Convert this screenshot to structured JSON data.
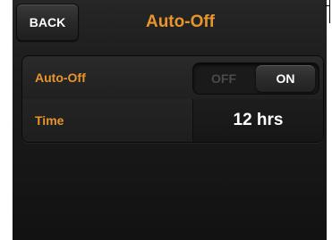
{
  "header": {
    "back_label": "BACK",
    "title": "Auto-Off"
  },
  "settings": {
    "auto_off": {
      "label": "Auto-Off",
      "off_label": "OFF",
      "on_label": "ON",
      "selected": "ON"
    },
    "time": {
      "label": "Time",
      "value": "12 hrs"
    }
  },
  "colors": {
    "accent": "#e8952e",
    "background": "#1c1c1c",
    "text": "#ffffff"
  }
}
